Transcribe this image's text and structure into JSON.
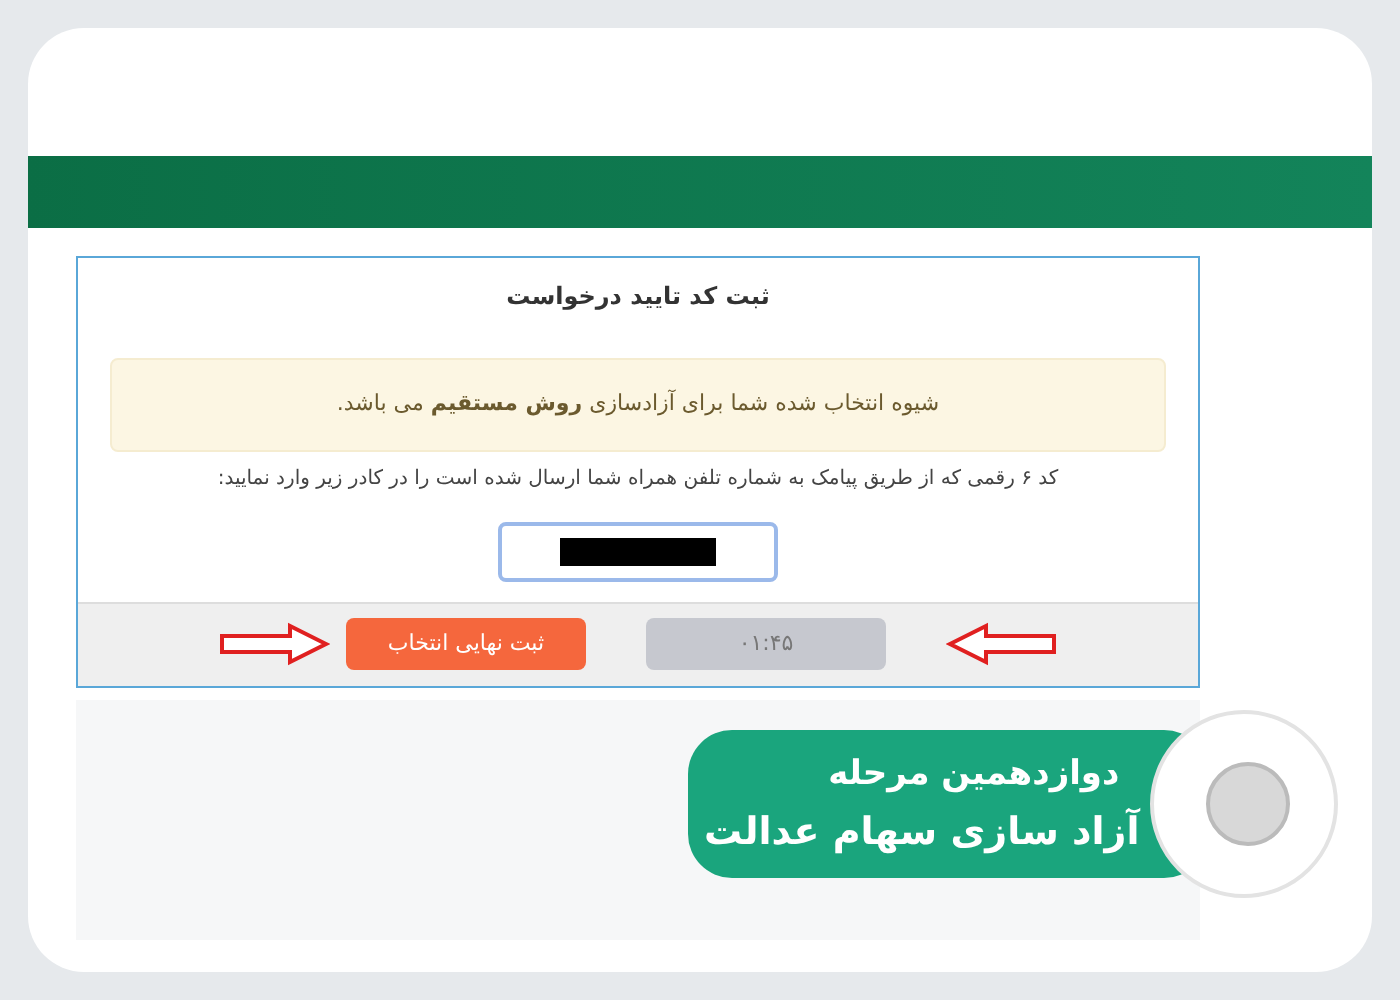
{
  "form": {
    "title": "ثبت کد تایید درخواست",
    "notice": "شیوه انتخاب شده شما برای آزادسازی **روش مستقیم** می باشد.",
    "instruction": "کد ۶ رقمی که از طریق پیامک به شماره تلفن همراه شما ارسال شده است را در کادر زیر وارد نمایید:",
    "buttons": [
      {
        "label": "۰۱:۴۵",
        "disabled": true
      },
      {
        "label": "ثبت نهایی انتخاب",
        "disabled": false
      }
    ]
  },
  "banner": {
    "lines": [
      "دوازدهمین مرحله",
      "آزاد سازی سهام عدالت"
    ]
  }
}
